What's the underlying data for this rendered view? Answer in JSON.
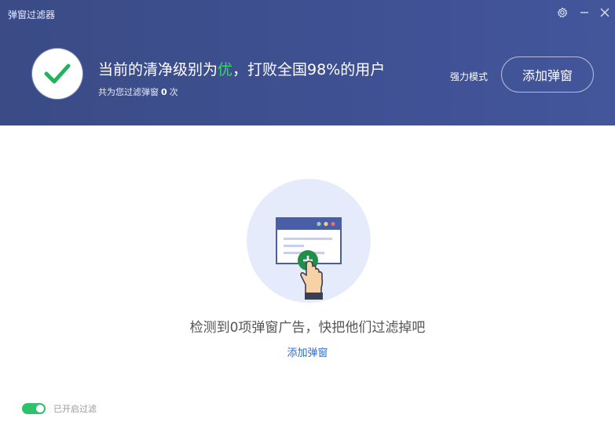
{
  "window": {
    "title": "弹窗过滤器",
    "controls": {
      "settings_icon": "gear-icon",
      "minimize_icon": "minimize-icon",
      "close_icon": "close-icon"
    }
  },
  "header": {
    "status_icon": "checkmark-icon",
    "headline_prefix": "当前的清净级别为",
    "headline_level": "优",
    "headline_suffix": "，打败全国98%的用户",
    "subline_prefix": "共为您过滤弹窗",
    "filtered_count": "0",
    "subline_suffix": "次",
    "strong_mode_label": "强力模式",
    "add_button_label": "添加弹窗"
  },
  "main": {
    "illustration": "add-popup-illustration",
    "empty_message": "检测到0项弹窗广告，快把他们过滤掉吧",
    "add_link_label": "添加弹窗"
  },
  "footer": {
    "filter_enabled": true,
    "toggle_label": "已开启过滤"
  },
  "colors": {
    "header_bg": "#3f5193",
    "accent_green": "#2dc26b",
    "link_blue": "#2f6bc8"
  }
}
